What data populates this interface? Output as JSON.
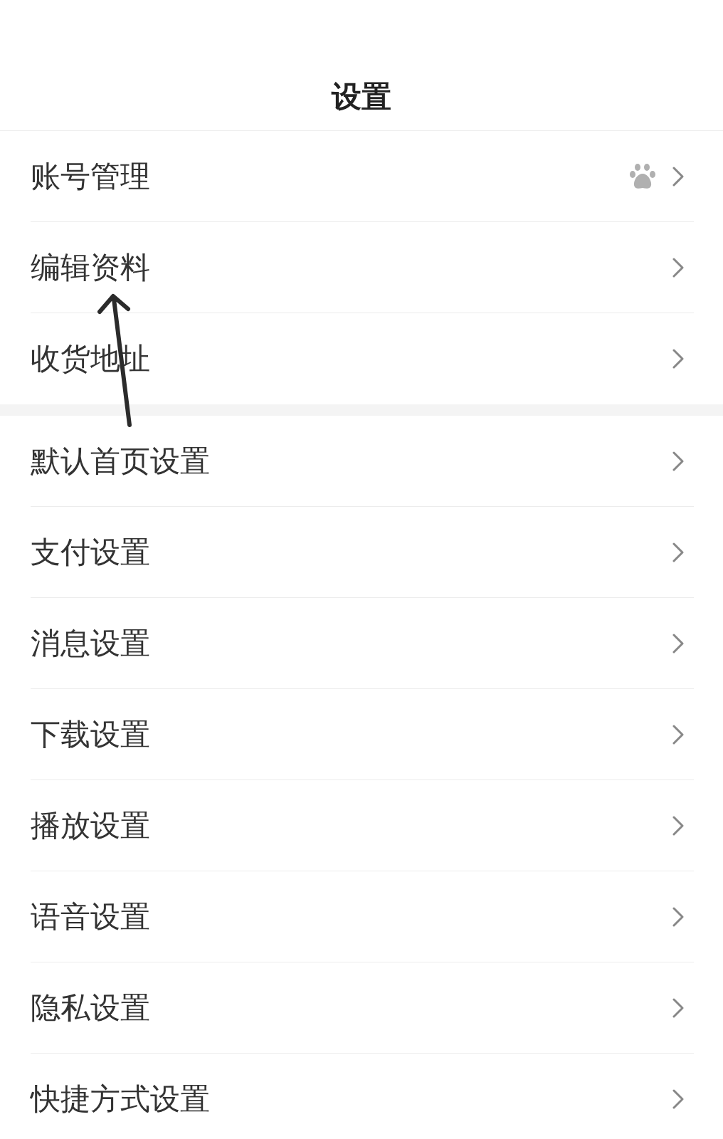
{
  "title": "设置",
  "sections": [
    {
      "items": [
        {
          "label": "账号管理",
          "kind": "badge"
        },
        {
          "label": "编辑资料",
          "kind": "plain"
        },
        {
          "label": "收货地址",
          "kind": "plain"
        }
      ]
    },
    {
      "items": [
        {
          "label": "默认首页设置",
          "kind": "plain"
        },
        {
          "label": "支付设置",
          "kind": "plain"
        },
        {
          "label": "消息设置",
          "kind": "plain"
        },
        {
          "label": "下载设置",
          "kind": "plain"
        },
        {
          "label": "播放设置",
          "kind": "plain"
        },
        {
          "label": "语音设置",
          "kind": "plain"
        },
        {
          "label": "隐私设置",
          "kind": "plain"
        },
        {
          "label": "快捷方式设置",
          "kind": "plain"
        }
      ]
    }
  ]
}
